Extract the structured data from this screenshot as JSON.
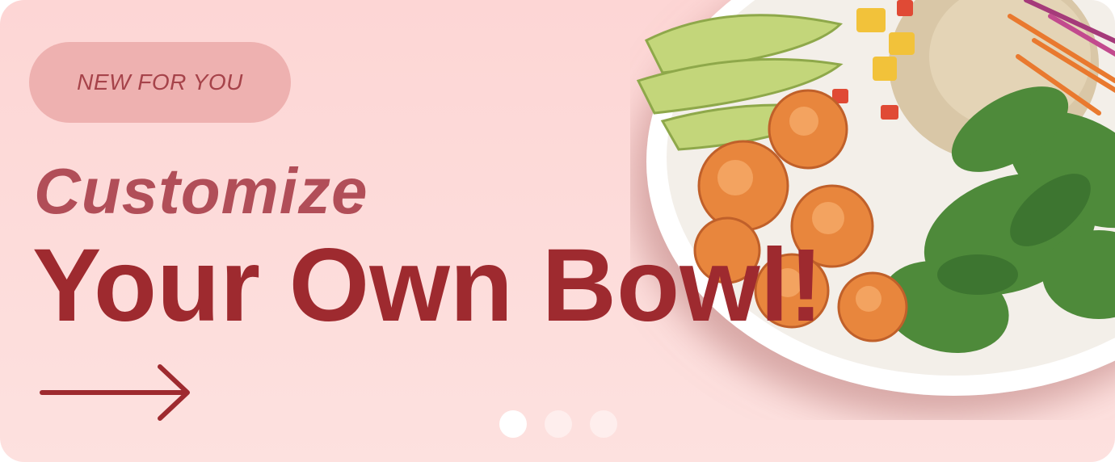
{
  "banner": {
    "badge_label": "NEW FOR YOU",
    "headline_line1": "Customize",
    "headline_line2": "Your Own Bowl!",
    "image_alt": "Bowl with shrimp, avocado, spinach, rice, mango and slaw",
    "arrow_icon": "arrow-right-icon"
  },
  "carousel": {
    "slide_count": 3,
    "active_index": 0
  },
  "colors": {
    "background": "#fdd9d8",
    "badge_background": "#eeb1b0",
    "headline_primary": "#9e2a2f",
    "headline_secondary": "#b14e58"
  }
}
